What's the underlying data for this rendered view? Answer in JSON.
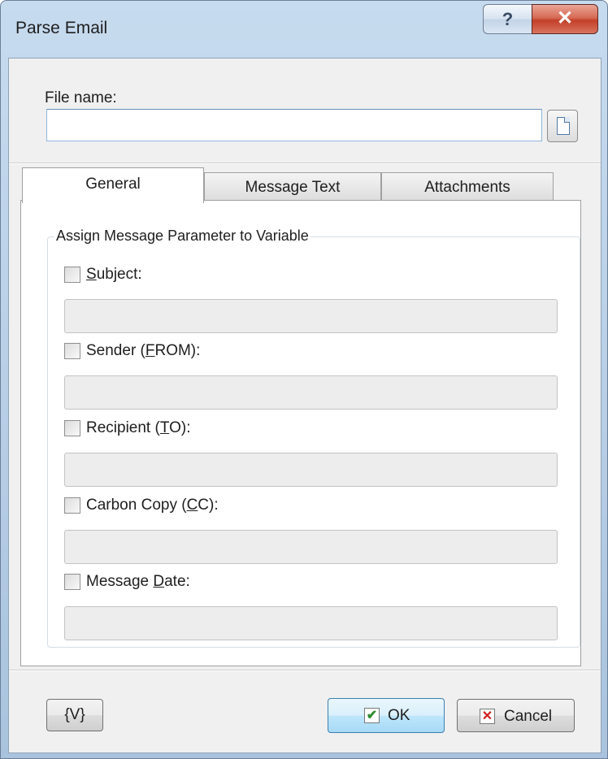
{
  "window": {
    "title": "Parse Email",
    "help_glyph": "?",
    "close_glyph": "✕"
  },
  "file": {
    "label": "File name:",
    "value": "",
    "browse_icon": "document-icon"
  },
  "tabs": [
    {
      "label": "General",
      "active": true
    },
    {
      "label": "Message Text",
      "active": false
    },
    {
      "label": "Attachments",
      "active": false
    }
  ],
  "group": {
    "title": "Assign Message Parameter to Variable"
  },
  "options": [
    {
      "pre": "",
      "key": "S",
      "post": "ubject:",
      "checked": false,
      "value": ""
    },
    {
      "pre": "Sender (",
      "key": "F",
      "post": "ROM):",
      "checked": false,
      "value": ""
    },
    {
      "pre": "Recipient (",
      "key": "T",
      "post": "O):",
      "checked": false,
      "value": ""
    },
    {
      "pre": "Carbon Copy (",
      "key": "C",
      "post": "C):",
      "checked": false,
      "value": ""
    },
    {
      "pre": "Message ",
      "key": "D",
      "post": "ate:",
      "checked": false,
      "value": ""
    }
  ],
  "buttons": {
    "variables": "{V}",
    "ok": "OK",
    "ok_icon": "✔",
    "cancel": "Cancel",
    "cancel_icon": "✕"
  },
  "colors": {
    "ok_icon": "#2e8b2e",
    "cancel_icon": "#d02020"
  }
}
